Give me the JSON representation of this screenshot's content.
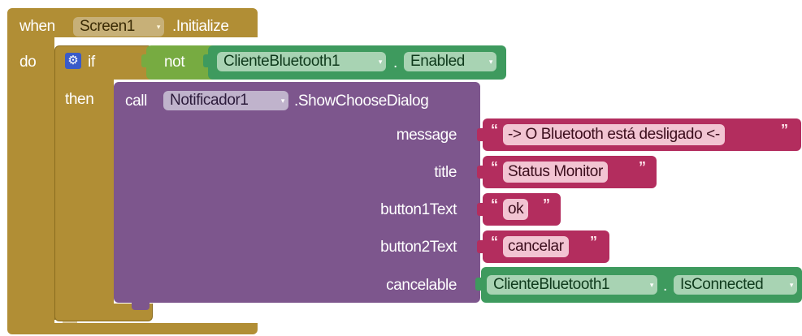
{
  "event": {
    "keyword_when": "when",
    "component": "Screen1",
    "event_name": ".Initialize",
    "keyword_do": "do"
  },
  "if_block": {
    "keyword_if": "if",
    "keyword_then": "then"
  },
  "condition": {
    "operator": "not",
    "component": "ClienteBluetooth1",
    "dot": ".",
    "property": "Enabled"
  },
  "call": {
    "keyword_call": "call",
    "component": "Notificador1",
    "method": ".ShowChooseDialog",
    "params": {
      "message": "message",
      "title": "title",
      "button1Text": "button1Text",
      "button2Text": "button2Text",
      "cancelable": "cancelable"
    }
  },
  "values": {
    "message": "-> O Bluetooth está desligado <-",
    "title": "Status Monitor",
    "button1Text": "ok",
    "button2Text": "cancelar",
    "cancelable_component": "ClienteBluetooth1",
    "cancelable_dot": ".",
    "cancelable_property": "IsConnected"
  },
  "glyphs": {
    "quote_open": "“",
    "quote_close": "”",
    "dropdown_arrow": "▾",
    "gear": "⚙"
  },
  "colors": {
    "control": "#b18e35",
    "procedure": "#7d568d",
    "text": "#b32d5e",
    "logic": "#77ab41",
    "component": "#3e9a5e",
    "white": "#ffffff"
  }
}
